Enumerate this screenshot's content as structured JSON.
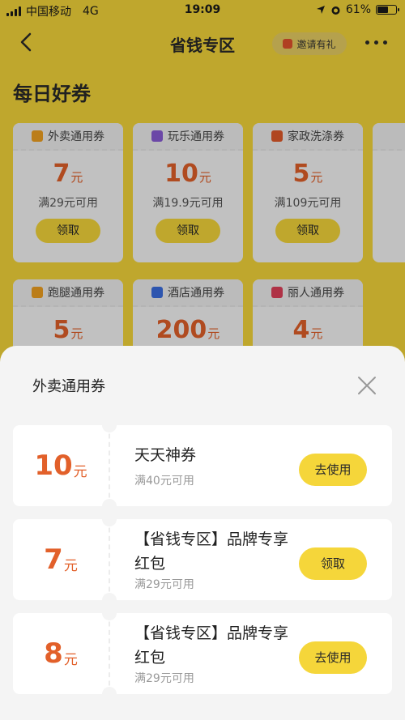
{
  "status_bar": {
    "carrier": "中国移动",
    "network": "4G",
    "time": "19:09",
    "battery": "61%",
    "battery_level": 0.61
  },
  "header": {
    "title": "省钱专区",
    "invite_label": "邀请有礼"
  },
  "section_title": "每日好券",
  "daily_coupons": [
    {
      "category": "外卖通用券",
      "amount": "7",
      "unit": "元",
      "condition": "满29元可用",
      "button": "领取",
      "icon_color": "#f0a020"
    },
    {
      "category": "玩乐通用券",
      "amount": "10",
      "unit": "元",
      "condition": "满19.9元可用",
      "button": "领取",
      "icon_color": "#8a5cd6"
    },
    {
      "category": "家政洗涤券",
      "amount": "5",
      "unit": "元",
      "condition": "满109元可用",
      "button": "领取",
      "icon_color": "#e25a2a"
    },
    {
      "category": "跑腿通用券",
      "amount": "5",
      "unit": "元",
      "icon_color": "#f0a020"
    },
    {
      "category": "酒店通用券",
      "amount": "200",
      "unit": "元",
      "icon_color": "#3a6ee0"
    },
    {
      "category": "丽人通用券",
      "amount": "4",
      "unit": "元",
      "icon_color": "#e0405a"
    }
  ],
  "sheet": {
    "title": "外卖通用券",
    "items": [
      {
        "amount": "10",
        "unit": "元",
        "name": "天天神券",
        "condition": "满40元可用",
        "button": "去使用"
      },
      {
        "amount": "7",
        "unit": "元",
        "name": "【省钱专区】品牌专享红包",
        "condition": "满29元可用",
        "button": "领取"
      },
      {
        "amount": "8",
        "unit": "元",
        "name": "【省钱专区】品牌专享红包",
        "condition": "满29元可用",
        "button": "去使用"
      }
    ]
  },
  "colors": {
    "brand_yellow": "#f5d63a",
    "amount_orange": "#e2602a"
  }
}
